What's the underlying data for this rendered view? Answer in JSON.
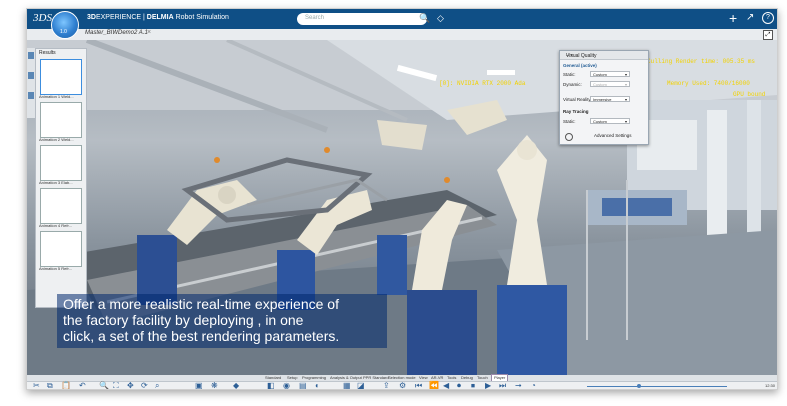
{
  "app": {
    "brand_strong": "3D",
    "brand_experience": "EXPERIENCE | ",
    "brand_product": "DELMIA",
    "brand_module": " Robot Simulation",
    "compass_version": "1.0"
  },
  "search": {
    "placeholder": "Search"
  },
  "document_tab": {
    "title": "Master_BIWDemo2 A.1"
  },
  "results_panel": {
    "title": "Results",
    "items": [
      {
        "label": "Animation 1 Weld..."
      },
      {
        "label": "Animation 2 Weld..."
      },
      {
        "label": "Animation 3 Elab..."
      },
      {
        "label": "Animation 4 Refr..."
      },
      {
        "label": "Animation 5 Refr..."
      }
    ]
  },
  "visual_quality": {
    "title": "Visual Quality",
    "section_general": "General (active)",
    "static_label": "Static:",
    "static_value": "Custom",
    "dynamic_label": "Dynamic:",
    "dynamic_value": "Custom",
    "vr_label": "Virtual Reality:",
    "vr_value": "Immersive",
    "section_ray": "Ray Tracing",
    "ray_static_label": "Static:",
    "ray_static_value": "Custom",
    "advanced_label": "Advanced Settings"
  },
  "gpu_overlay": {
    "line1": "[0]: NVIDIA RTX 2000 Ada",
    "line2": "Culling Render time: 005.35 ms",
    "line3": "Memory Used: 7400/16000",
    "line4": "GPU bound"
  },
  "caption": {
    "line1": "Offer a more realistic real-time experience of",
    "line2": "the factory facility by deploying , in one",
    "line3": "click, a set of  the best rendering parameters."
  },
  "workbench_tabs": [
    "Standard",
    "Setup",
    "Programming",
    "Analysis & Output",
    "PPR Standard",
    "Selection mode",
    "View",
    "AR-VR",
    "Tools",
    "Debug",
    "Touch",
    "Player"
  ],
  "active_workbench_tab": "Player",
  "timeline": {
    "time": "12:30",
    "progress": 0.35
  }
}
